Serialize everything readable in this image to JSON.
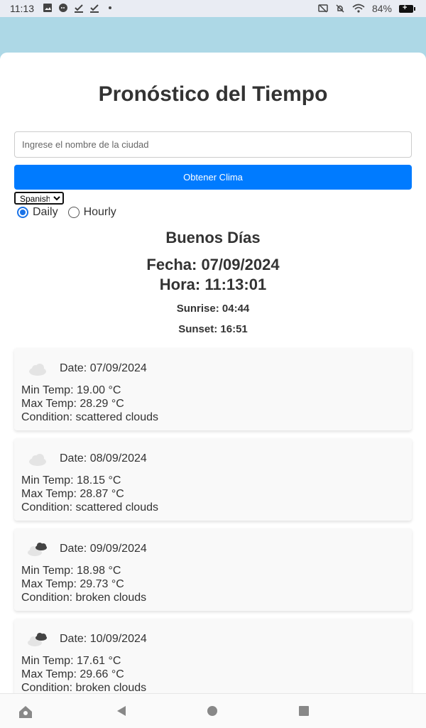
{
  "status_bar": {
    "time": "11:13",
    "battery": "84%",
    "left_icons": [
      "image-icon",
      "chat-icon",
      "check-icon",
      "check-icon",
      "dot-icon"
    ],
    "right_icons": [
      "cast-icon",
      "bell-off-icon",
      "wifi-icon",
      "battery-icon"
    ]
  },
  "app": {
    "title": "Pronóstico del Tiempo",
    "city_placeholder": "Ingrese el nombre de la ciudad",
    "get_weather_label": "Obtener Clima",
    "language": "Spanish",
    "radio_daily": "Daily",
    "radio_hourly": "Hourly",
    "selected_mode": "Daily",
    "greeting": "Buenos Días",
    "fecha": "Fecha: 07/09/2024",
    "hora": "Hora: 11:13:01",
    "sunrise": "Sunrise: 04:44",
    "sunset": "Sunset: 16:51",
    "accent_color": "#007bff",
    "background_color": "#add8e6"
  },
  "forecast": [
    {
      "date": "Date: 07/09/2024",
      "min": "Min Temp: 19.00 °C",
      "max": "Max Temp: 28.29 °C",
      "condition": "Condition: scattered clouds",
      "icon": "scattered-clouds-icon"
    },
    {
      "date": "Date: 08/09/2024",
      "min": "Min Temp: 18.15 °C",
      "max": "Max Temp: 28.87 °C",
      "condition": "Condition: scattered clouds",
      "icon": "scattered-clouds-icon"
    },
    {
      "date": "Date: 09/09/2024",
      "min": "Min Temp: 18.98 °C",
      "max": "Max Temp: 29.73 °C",
      "condition": "Condition: broken clouds",
      "icon": "broken-clouds-icon"
    },
    {
      "date": "Date: 10/09/2024",
      "min": "Min Temp: 17.61 °C",
      "max": "Max Temp: 29.66 °C",
      "condition": "Condition: broken clouds",
      "icon": "broken-clouds-icon"
    }
  ],
  "nav_bar": {
    "buttons": [
      "home-icon",
      "back-icon",
      "home-circle-icon",
      "recents-icon"
    ]
  }
}
